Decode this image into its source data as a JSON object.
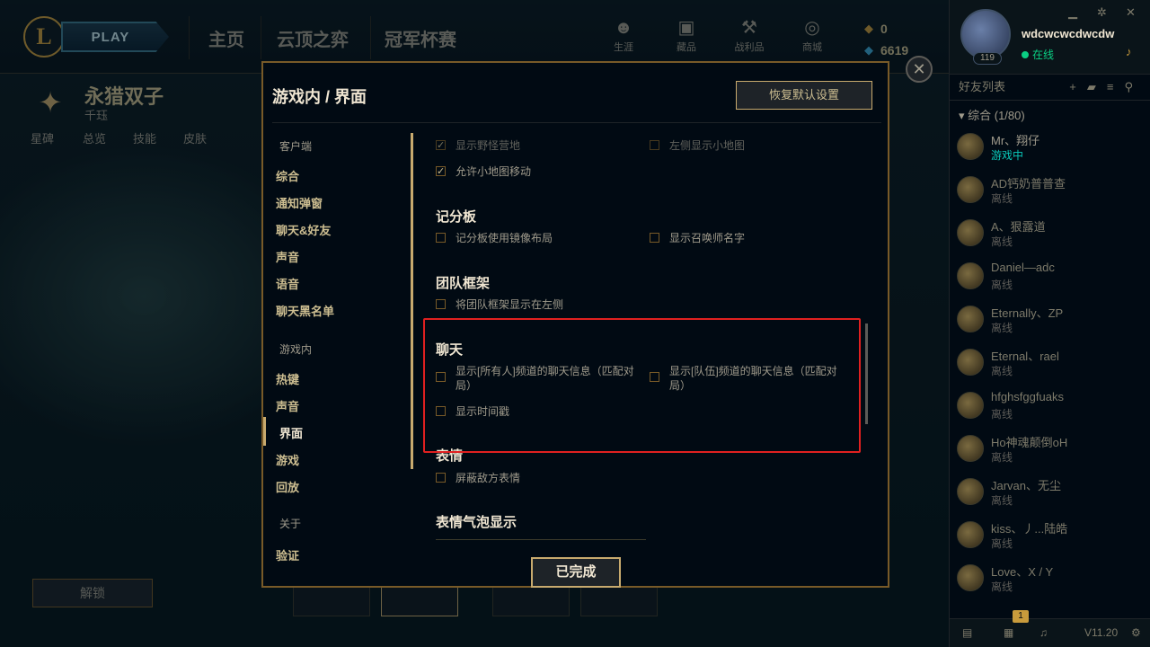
{
  "nav": {
    "play_label": "PLAY",
    "tabs": [
      "主页",
      "云顶之弈",
      "冠军杯赛"
    ],
    "icons": [
      {
        "icon": "profile-icon",
        "label": "生涯"
      },
      {
        "icon": "collection-icon",
        "label": "藏品"
      },
      {
        "icon": "loot-icon",
        "label": "战利品"
      },
      {
        "icon": "store-icon",
        "label": "商城"
      }
    ],
    "rp": "0",
    "be": "6619"
  },
  "profile": {
    "name": "wdcwcwcdwcdw",
    "level": "119",
    "status": "在线"
  },
  "champion": {
    "name": "永猎双子",
    "title": "千珏",
    "tabs": [
      "星碑",
      "总览",
      "技能",
      "皮肤"
    ],
    "unlock_label": "解锁"
  },
  "modal": {
    "breadcrumb": "游戏内 / 界面",
    "restore_label": "恢复默认设置",
    "done_label": "已完成",
    "close_glyph": "✕",
    "menu": {
      "client_header": "客户端",
      "client_items": [
        "综合",
        "通知弹窗",
        "聊天&好友",
        "声音",
        "语音",
        "聊天黑名单"
      ],
      "ingame_header": "游戏内",
      "ingame_items": [
        "热键",
        "声音",
        "界面",
        "游戏",
        "回放"
      ],
      "about_header": "关于",
      "about_items": [
        "验证"
      ]
    },
    "content": {
      "top_opts": [
        {
          "label": "显示野怪营地",
          "checked": true
        },
        {
          "label": "左侧显示小地图",
          "checked": false
        },
        {
          "label": "允许小地图移动",
          "checked": true
        }
      ],
      "scoreboard": {
        "title": "记分板",
        "opts": [
          {
            "label": "记分板使用镜像布局",
            "checked": false
          },
          {
            "label": "显示召唤师名字",
            "checked": false
          }
        ]
      },
      "team_frame": {
        "title": "团队框架",
        "opts": [
          {
            "label": "将团队框架显示在左侧",
            "checked": false
          }
        ]
      },
      "chat": {
        "title": "聊天",
        "opts": [
          {
            "label": "显示[所有人]频道的聊天信息（匹配对局）",
            "checked": false
          },
          {
            "label": "显示[队伍]频道的聊天信息（匹配对局）",
            "checked": false
          },
          {
            "label": "显示时间戳",
            "checked": false
          }
        ]
      },
      "emotes": {
        "title": "表情",
        "opts": [
          {
            "label": "屏蔽敌方表情",
            "checked": false
          }
        ]
      },
      "emote_bubble": {
        "title": "表情气泡显示"
      }
    }
  },
  "social": {
    "header": "好友列表",
    "group": "综合 (1/80)",
    "friends": [
      {
        "name": "Mr、翔仔",
        "status": "游戏中",
        "ingame": true
      },
      {
        "name": "AD钙奶普普查",
        "status": "离线",
        "ingame": false
      },
      {
        "name": "A、狠露道",
        "status": "离线",
        "ingame": false
      },
      {
        "name": "Daniel—adc",
        "status": "离线",
        "ingame": false
      },
      {
        "name": "Eternally、ZP",
        "status": "离线",
        "ingame": false
      },
      {
        "name": "Eternal、rael",
        "status": "离线",
        "ingame": false
      },
      {
        "name": "hfghsfggfuaks",
        "status": "离线",
        "ingame": false
      },
      {
        "name": "Ho神魂颠倒oH",
        "status": "离线",
        "ingame": false
      },
      {
        "name": "Jarvan、无尘",
        "status": "离线",
        "ingame": false
      },
      {
        "name": "kiss、丿...陆皓",
        "status": "离线",
        "ingame": false
      },
      {
        "name": "Love、X / Y",
        "status": "离线",
        "ingame": false
      }
    ],
    "badge": "1",
    "version": "V11.20"
  },
  "colors": {
    "gold": "#c8aa6e",
    "highlight": "#e02020",
    "online": "#0acf83"
  }
}
